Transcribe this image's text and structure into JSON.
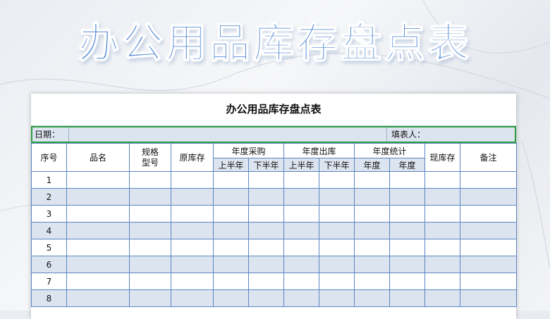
{
  "banner_title": "办公用品库存盘点表",
  "sheet": {
    "title": "办公用品库存盘点表",
    "date_label": "日期：",
    "filler_label": "填表人："
  },
  "headers": {
    "seq": "序号",
    "name": "品名",
    "spec": "规格\n型号",
    "orig_stock": "原库存",
    "annual_purchase": "年度采购",
    "annual_out": "年度出库",
    "annual_stats": "年度统计",
    "current_stock": "现库存",
    "remark": "备注",
    "purchase_h1": "上半年",
    "purchase_h2": "下半年",
    "out_h1": "上半年",
    "out_h2": "下半年",
    "stats_1": "年度",
    "stats_2": "年度"
  },
  "rows": [
    "1",
    "2",
    "3",
    "4",
    "5",
    "6",
    "7",
    "8"
  ],
  "colors": {
    "accent": "#5b8fd6",
    "row_band": "#dce4ef",
    "grid": "#5b86c2",
    "selection": "#2e9d3e"
  }
}
